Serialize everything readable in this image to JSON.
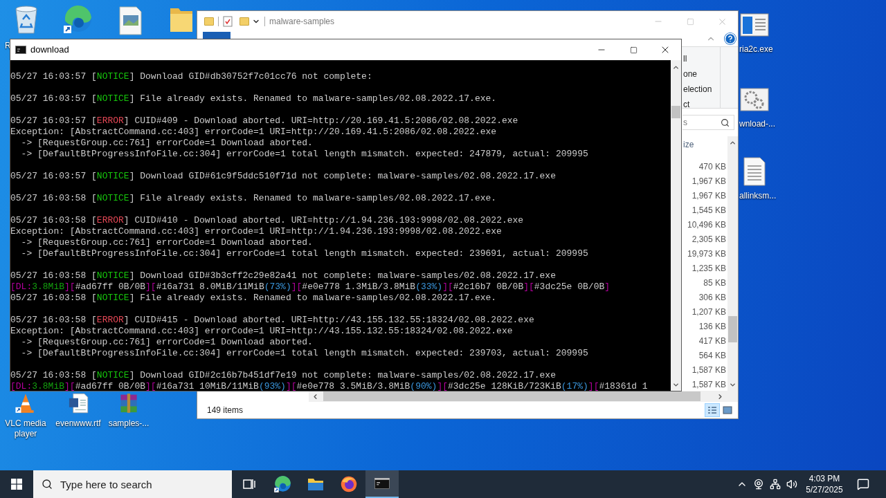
{
  "desktop": {
    "top_icons": [
      {
        "kind": "recycle-bin",
        "label": "R"
      },
      {
        "kind": "browser"
      },
      {
        "kind": "image-file"
      },
      {
        "kind": "folder"
      }
    ],
    "right_icons": [
      {
        "kind": "window",
        "label": "ria2c.exe"
      },
      {
        "kind": "gears",
        "label": "wnload-..."
      },
      {
        "kind": "text-file",
        "label": "allinksm..."
      }
    ],
    "bottom_icons": [
      {
        "kind": "traffic-cone",
        "label": "VLC media player"
      },
      {
        "kind": "document",
        "label": "evenwww.rtf"
      },
      {
        "kind": "archive",
        "label": "samples-..."
      }
    ]
  },
  "explorer": {
    "title": "malware-samples",
    "ribbon_items": [
      "ll",
      "one",
      "election",
      "ct"
    ],
    "search_text": "s",
    "size_header": "ize",
    "sizes": [
      "470 KB",
      "1,967 KB",
      "1,967 KB",
      "1,545 KB",
      "10,496 KB",
      "2,305 KB",
      "19,973 KB",
      "1,235 KB",
      "85 KB",
      "306 KB",
      "1,207 KB",
      "136 KB",
      "417 KB",
      "564 KB",
      "1,587 KB",
      "1,587 KB"
    ],
    "status": "149 items",
    "views": [
      {
        "kind": "details",
        "selected": true
      },
      {
        "kind": "thumbnails",
        "selected": false
      }
    ]
  },
  "console": {
    "title": "download",
    "blocks": [
      [
        [
          {
            "text": "05/27 16:03:57 [",
            "kind": "plain"
          },
          {
            "text": "NOTICE",
            "kind": "notice"
          },
          {
            "text": "] Download GID#db30752f7c01cc76 not complete:",
            "kind": "plain"
          }
        ]
      ],
      [
        [
          {
            "text": "05/27 16:03:57 [",
            "kind": "plain"
          },
          {
            "text": "NOTICE",
            "kind": "notice"
          },
          {
            "text": "] File already exists. Renamed to malware-samples/02.08.2022.17.exe.",
            "kind": "plain"
          }
        ]
      ],
      [
        [
          {
            "text": "05/27 16:03:57 [",
            "kind": "plain"
          },
          {
            "text": "ERROR",
            "kind": "error"
          },
          {
            "text": "] CUID#409 - Download aborted. URI=http://20.169.41.5:2086/02.08.2022.exe",
            "kind": "plain"
          }
        ],
        [
          {
            "text": "Exception: [AbstractCommand.cc:403] errorCode=1 URI=http://20.169.41.5:2086/02.08.2022.exe",
            "kind": "plain"
          }
        ],
        [
          {
            "text": "  -> [RequestGroup.cc:761] errorCode=1 Download aborted.",
            "kind": "plain"
          }
        ],
        [
          {
            "text": "  -> [DefaultBtProgressInfoFile.cc:304] errorCode=1 total length mismatch. expected: 247879, actual: 209995",
            "kind": "plain"
          }
        ]
      ],
      [
        [
          {
            "text": "05/27 16:03:57 [",
            "kind": "plain"
          },
          {
            "text": "NOTICE",
            "kind": "notice"
          },
          {
            "text": "] Download GID#61c9f5ddc510f71d not complete: malware-samples/02.08.2022.17.exe",
            "kind": "plain"
          }
        ]
      ],
      [
        [
          {
            "text": "05/27 16:03:58 [",
            "kind": "plain"
          },
          {
            "text": "NOTICE",
            "kind": "notice"
          },
          {
            "text": "] File already exists. Renamed to malware-samples/02.08.2022.17.exe.",
            "kind": "plain"
          }
        ]
      ],
      [
        [
          {
            "text": "05/27 16:03:58 [",
            "kind": "plain"
          },
          {
            "text": "ERROR",
            "kind": "error"
          },
          {
            "text": "] CUID#410 - Download aborted. URI=http://1.94.236.193:9998/02.08.2022.exe",
            "kind": "plain"
          }
        ],
        [
          {
            "text": "Exception: [AbstractCommand.cc:403] errorCode=1 URI=http://1.94.236.193:9998/02.08.2022.exe",
            "kind": "plain"
          }
        ],
        [
          {
            "text": "  -> [RequestGroup.cc:761] errorCode=1 Download aborted.",
            "kind": "plain"
          }
        ],
        [
          {
            "text": "  -> [DefaultBtProgressInfoFile.cc:304] errorCode=1 total length mismatch. expected: 239691, actual: 209995",
            "kind": "plain"
          }
        ]
      ],
      [
        [
          {
            "text": "05/27 16:03:58 [",
            "kind": "plain"
          },
          {
            "text": "NOTICE",
            "kind": "notice"
          },
          {
            "text": "] Download GID#3b3cff2c29e82a41 not complete: malware-samples/02.08.2022.17.exe",
            "kind": "plain"
          }
        ],
        [
          {
            "text": "[DL:",
            "kind": "bracket"
          },
          {
            "text": "3.8MiB",
            "kind": "speed"
          },
          {
            "text": "][",
            "kind": "bracket"
          },
          {
            "text": "#ad67ff 0B/0B",
            "kind": "plain"
          },
          {
            "text": "][",
            "kind": "bracket"
          },
          {
            "text": "#16a731 8.0MiB/11MiB",
            "kind": "plain"
          },
          {
            "text": "(73%)",
            "kind": "percent"
          },
          {
            "text": "][",
            "kind": "bracket"
          },
          {
            "text": "#e0e778 1.3MiB/3.8MiB",
            "kind": "plain"
          },
          {
            "text": "(33%)",
            "kind": "percent"
          },
          {
            "text": "][",
            "kind": "bracket"
          },
          {
            "text": "#2c16b7 0B/0B",
            "kind": "plain"
          },
          {
            "text": "][",
            "kind": "bracket"
          },
          {
            "text": "#3dc25e 0B/0B",
            "kind": "plain"
          },
          {
            "text": "]",
            "kind": "bracket"
          }
        ],
        [
          {
            "text": "05/27 16:03:58 [",
            "kind": "plain"
          },
          {
            "text": "NOTICE",
            "kind": "notice"
          },
          {
            "text": "] File already exists. Renamed to malware-samples/02.08.2022.17.exe.",
            "kind": "plain"
          }
        ]
      ],
      [
        [
          {
            "text": "05/27 16:03:58 [",
            "kind": "plain"
          },
          {
            "text": "ERROR",
            "kind": "error"
          },
          {
            "text": "] CUID#415 - Download aborted. URI=http://43.155.132.55:18324/02.08.2022.exe",
            "kind": "plain"
          }
        ],
        [
          {
            "text": "Exception: [AbstractCommand.cc:403] errorCode=1 URI=http://43.155.132.55:18324/02.08.2022.exe",
            "kind": "plain"
          }
        ],
        [
          {
            "text": "  -> [RequestGroup.cc:761] errorCode=1 Download aborted.",
            "kind": "plain"
          }
        ],
        [
          {
            "text": "  -> [DefaultBtProgressInfoFile.cc:304] errorCode=1 total length mismatch. expected: 239703, actual: 209995",
            "kind": "plain"
          }
        ]
      ],
      [
        [
          {
            "text": "05/27 16:03:58 [",
            "kind": "plain"
          },
          {
            "text": "NOTICE",
            "kind": "notice"
          },
          {
            "text": "] Download GID#2c16b7b451df7e19 not complete: malware-samples/02.08.2022.17.exe",
            "kind": "plain"
          }
        ],
        [
          {
            "text": "[DL:",
            "kind": "bracket"
          },
          {
            "text": "3.8MiB",
            "kind": "speed"
          },
          {
            "text": "][",
            "kind": "bracket"
          },
          {
            "text": "#ad67ff 0B/0B",
            "kind": "plain"
          },
          {
            "text": "][",
            "kind": "bracket"
          },
          {
            "text": "#16a731 10MiB/11MiB",
            "kind": "plain"
          },
          {
            "text": "(93%)",
            "kind": "percent"
          },
          {
            "text": "][",
            "kind": "bracket"
          },
          {
            "text": "#e0e778 3.5MiB/3.8MiB",
            "kind": "plain"
          },
          {
            "text": "(90%)",
            "kind": "percent"
          },
          {
            "text": "][",
            "kind": "bracket"
          },
          {
            "text": "#3dc25e 128KiB/723KiB",
            "kind": "plain"
          },
          {
            "text": "(17%)",
            "kind": "percent"
          },
          {
            "text": "][",
            "kind": "bracket"
          },
          {
            "text": "#18361d 1",
            "kind": "plain"
          }
        ]
      ]
    ]
  },
  "taskbar": {
    "search_placeholder": "Type here to search",
    "apps": [
      {
        "kind": "task-view",
        "selected": false
      },
      {
        "kind": "browser",
        "selected": false
      },
      {
        "kind": "folder",
        "selected": false
      },
      {
        "kind": "firefox",
        "selected": false
      },
      {
        "kind": "terminal",
        "selected": true
      }
    ],
    "time": "4:03 PM",
    "date": "5/27/2025"
  }
}
